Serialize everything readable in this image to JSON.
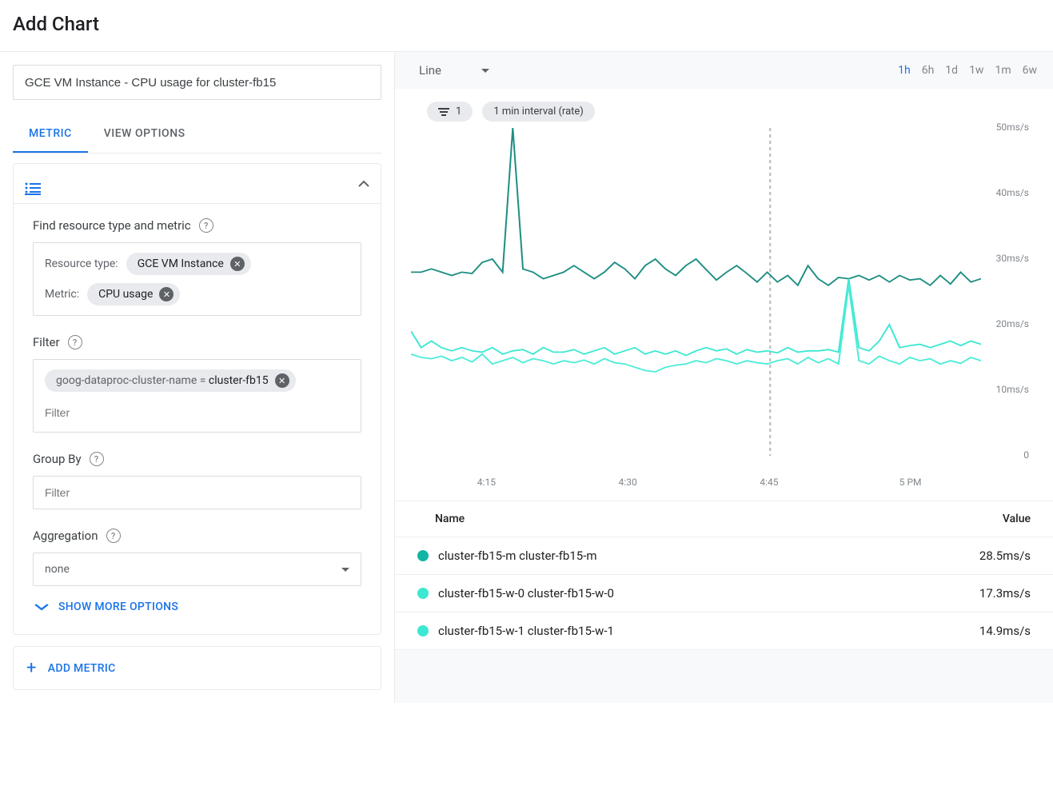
{
  "header": {
    "title": "Add Chart"
  },
  "left": {
    "chart_title": "GCE VM Instance - CPU usage for cluster-fb15",
    "tabs": {
      "metric": "METRIC",
      "view_options": "VIEW OPTIONS"
    },
    "section": {
      "find_label": "Find resource type and metric",
      "resource_type_label": "Resource type:",
      "resource_type_value": "GCE VM Instance",
      "metric_label": "Metric:",
      "metric_value": "CPU usage",
      "filter_label": "Filter",
      "filter_chip_key": "goog-dataproc-cluster-name = ",
      "filter_chip_value": "cluster-fb15",
      "filter_placeholder": "Filter",
      "group_by_label": "Group By",
      "group_by_placeholder": "Filter",
      "agg_label": "Aggregation",
      "agg_value": "none",
      "show_more": "SHOW MORE OPTIONS",
      "add_metric": "ADD METRIC"
    }
  },
  "right": {
    "viztype": "Line",
    "ranges": [
      "1h",
      "6h",
      "1d",
      "1w",
      "1m",
      "6w"
    ],
    "active_range": "1h",
    "pill_filter": "1",
    "pill_interval": "1 min interval (rate)",
    "legend": {
      "name_col": "Name",
      "value_col": "Value",
      "rows": [
        {
          "color": "#12B5A5",
          "name": "cluster-fb15-m cluster-fb15-m",
          "value": "28.5ms/s"
        },
        {
          "color": "#3DE8D2",
          "name": "cluster-fb15-w-0 cluster-fb15-w-0",
          "value": "17.3ms/s"
        },
        {
          "color": "#3DE8D2",
          "name": "cluster-fb15-w-1 cluster-fb15-w-1",
          "value": "14.9ms/s"
        }
      ]
    }
  },
  "chart_data": {
    "type": "line",
    "xlabel": "",
    "ylabel": "",
    "ytick_labels": [
      "0",
      "10ms/s",
      "20ms/s",
      "30ms/s",
      "40ms/s",
      "50ms/s"
    ],
    "ylim": [
      0,
      50
    ],
    "x_ticks": [
      "4:15",
      "4:30",
      "4:45",
      "5 PM"
    ],
    "cursor_at": "4:45",
    "series": [
      {
        "name": "cluster-fb15-m",
        "color": "#1E8E82",
        "values": [
          28,
          28,
          28.5,
          28,
          27.5,
          28,
          27.8,
          29.5,
          30,
          28,
          50,
          28.5,
          28,
          27,
          27.5,
          28,
          29,
          28,
          27,
          28,
          29.5,
          28.5,
          27,
          29,
          30,
          28.5,
          27.5,
          29,
          30,
          28.4,
          26.8,
          28,
          29,
          27.8,
          26.5,
          28,
          26.5,
          27.5,
          26,
          29,
          27,
          26,
          27.2,
          27,
          27.5,
          26.8,
          27.5,
          26.5,
          27.5,
          26.8,
          27,
          26,
          27.5,
          26.2,
          28,
          26.5,
          27
        ]
      },
      {
        "name": "cluster-fb15-w-0",
        "color": "#3DE8D2",
        "values": [
          19,
          16.5,
          17.5,
          16.5,
          16,
          16.5,
          16,
          15.8,
          16.5,
          15.5,
          16,
          16.2,
          15.5,
          16.5,
          15.8,
          15.8,
          16.2,
          15.5,
          16,
          16.5,
          15.5,
          16,
          16.5,
          15.5,
          16,
          15.5,
          16,
          15.3,
          16,
          16.5,
          16,
          16.3,
          15.5,
          16.2,
          15.8,
          16,
          15.7,
          16.5,
          15.8,
          16,
          16,
          16.2,
          15.8,
          27,
          16.5,
          16,
          17.5,
          20,
          16.5,
          16.8,
          17,
          16.5,
          17,
          17.5,
          16.8,
          17.5,
          17
        ]
      },
      {
        "name": "cluster-fb15-w-1",
        "color": "#4DECD8",
        "values": [
          15.5,
          15,
          14.8,
          15.2,
          14.5,
          15,
          14.3,
          15.5,
          14,
          14.5,
          15,
          14.2,
          14.8,
          14.5,
          14,
          14.5,
          14.2,
          14.6,
          14,
          14.8,
          14.2,
          14,
          13.5,
          13,
          12.8,
          13.5,
          13.8,
          14,
          14.5,
          14.2,
          14.8,
          14.5,
          14,
          14.5,
          14.2,
          14,
          14.5,
          14.8,
          14,
          15,
          14.2,
          14.8,
          14,
          26,
          14.5,
          14,
          15.2,
          14.5,
          14,
          15,
          14.5,
          14.8,
          14,
          14.5,
          14.1,
          15,
          14.5
        ]
      }
    ]
  }
}
